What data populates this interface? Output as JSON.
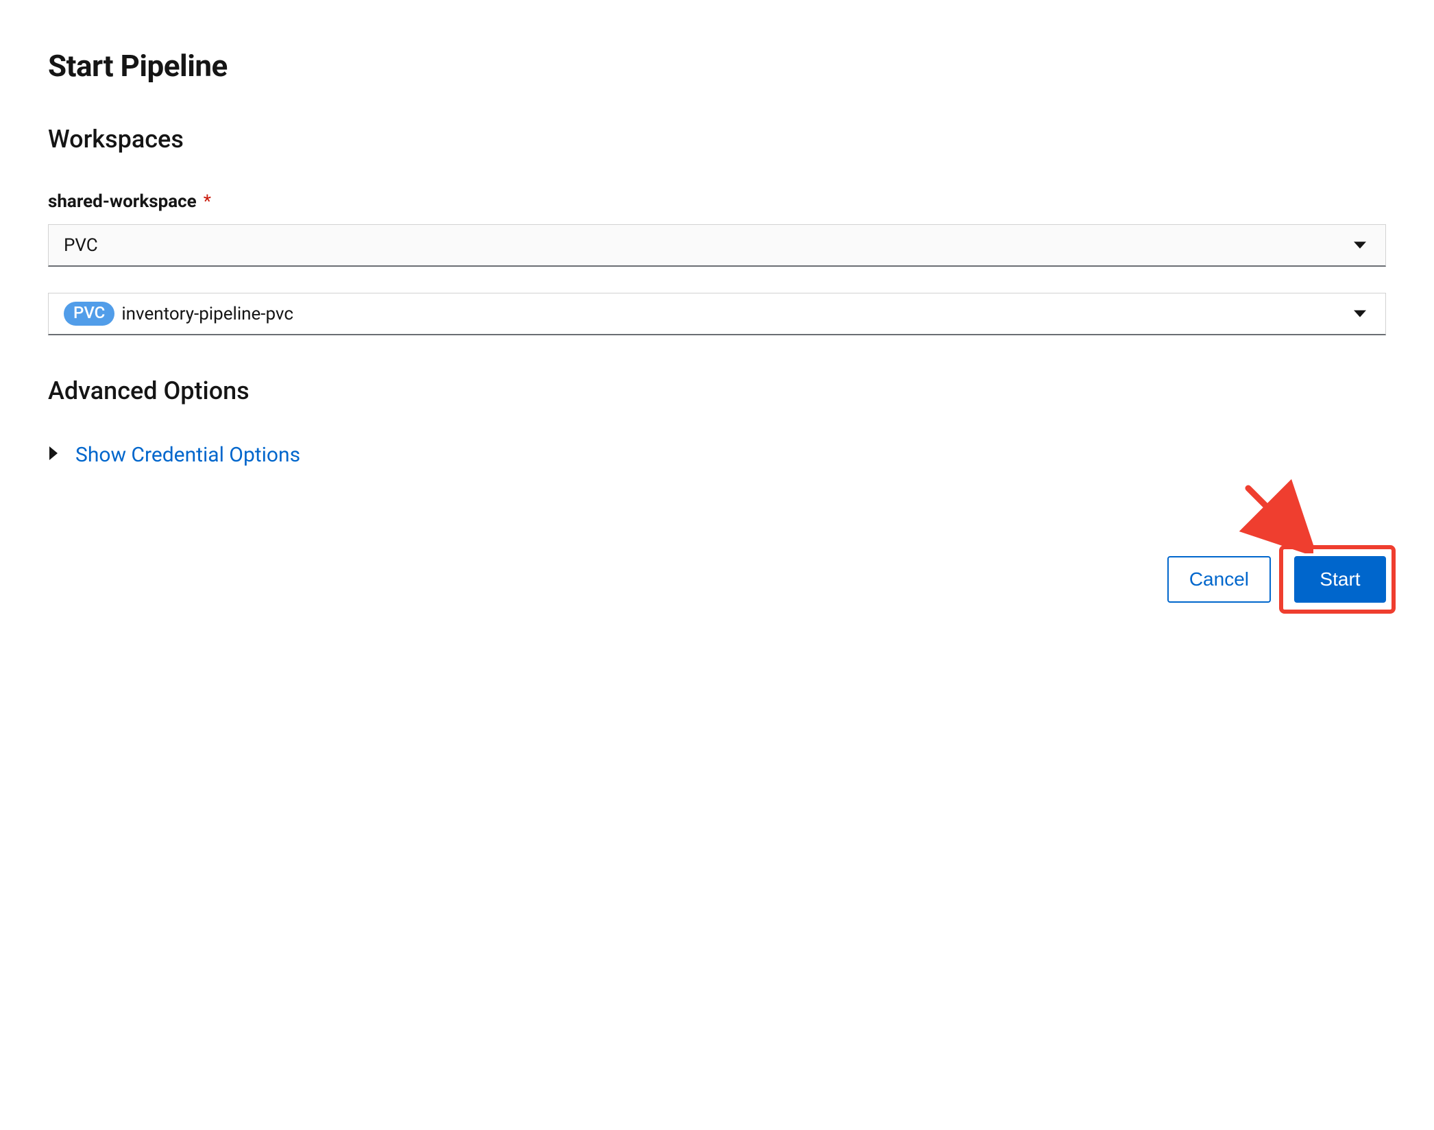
{
  "dialog": {
    "title": "Start Pipeline"
  },
  "workspaces": {
    "heading": "Workspaces",
    "field_label": "shared-workspace",
    "required_marker": "*",
    "type_select": {
      "value": "PVC"
    },
    "pvc_select": {
      "badge": "PVC",
      "value": "inventory-pipeline-pvc"
    }
  },
  "advanced": {
    "heading": "Advanced Options",
    "expand_label": "Show Credential Options"
  },
  "footer": {
    "cancel": "Cancel",
    "start": "Start"
  }
}
